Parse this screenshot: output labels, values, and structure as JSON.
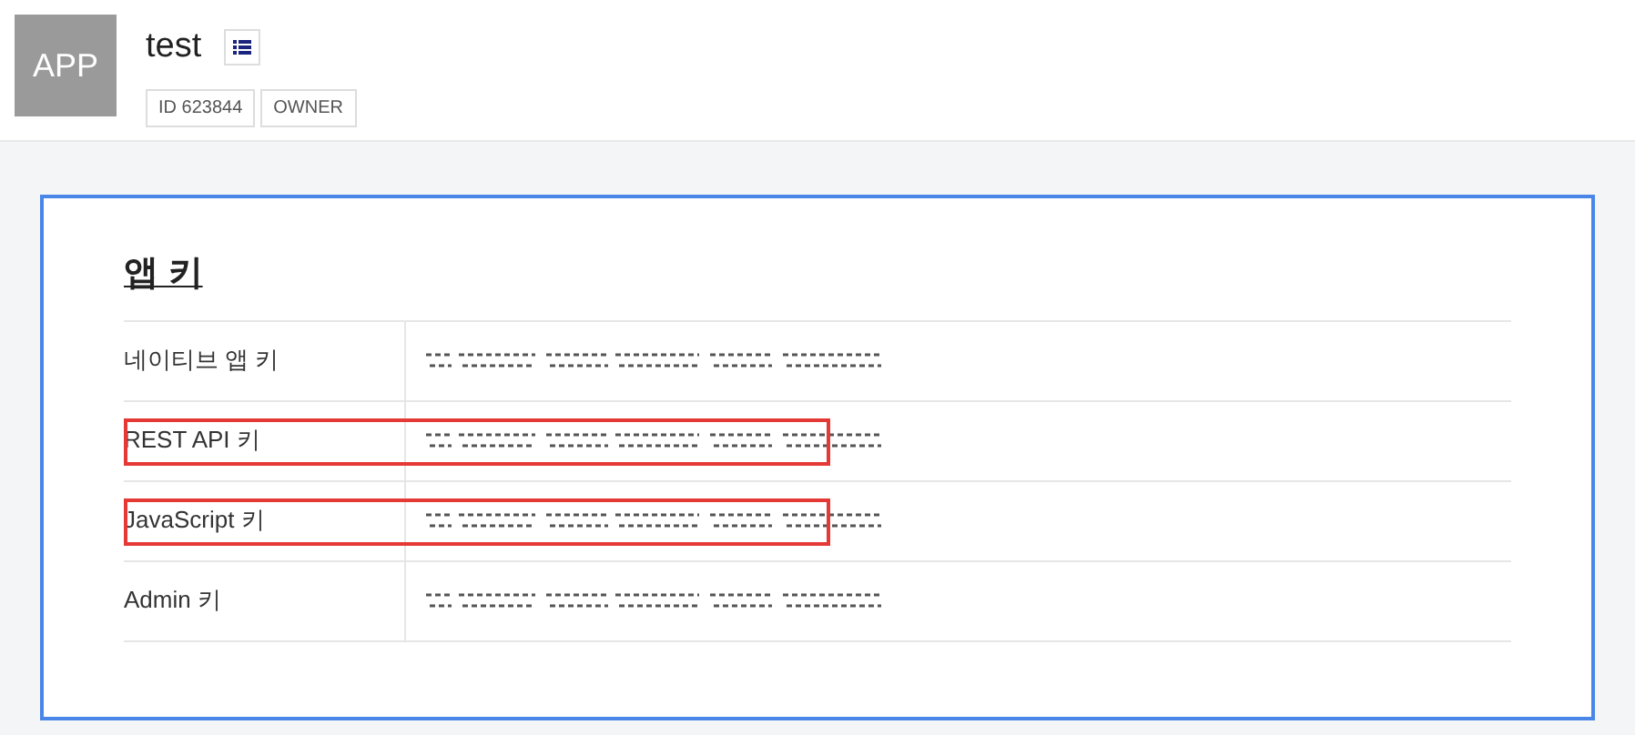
{
  "app": {
    "icon_label": "APP",
    "name": "test",
    "badges": [
      "ID 623844",
      "OWNER"
    ]
  },
  "section": {
    "title": "앱 키",
    "rows": [
      {
        "label": "네이티브 앱 키",
        "highlighted": false
      },
      {
        "label": "REST API 키",
        "highlighted": true
      },
      {
        "label": "JavaScript 키",
        "highlighted": true
      },
      {
        "label": "Admin 키",
        "highlighted": false
      }
    ]
  }
}
